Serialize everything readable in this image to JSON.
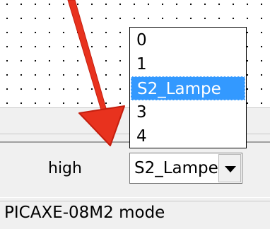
{
  "properties": {
    "label": "high",
    "selected_value": "S2_Lampe"
  },
  "dropdown": {
    "options": [
      "0",
      "1",
      "S2_Lampe",
      "3",
      "4"
    ],
    "selected_index": 2
  },
  "status_bar": {
    "mode_text": "PICAXE-08M2 mode"
  },
  "colors": {
    "selection": "#3399ff",
    "annotation_arrow": "#e8321e"
  },
  "icons": {
    "combo_button": "chevron-down-icon",
    "annotation": "red-arrow-annotation"
  }
}
